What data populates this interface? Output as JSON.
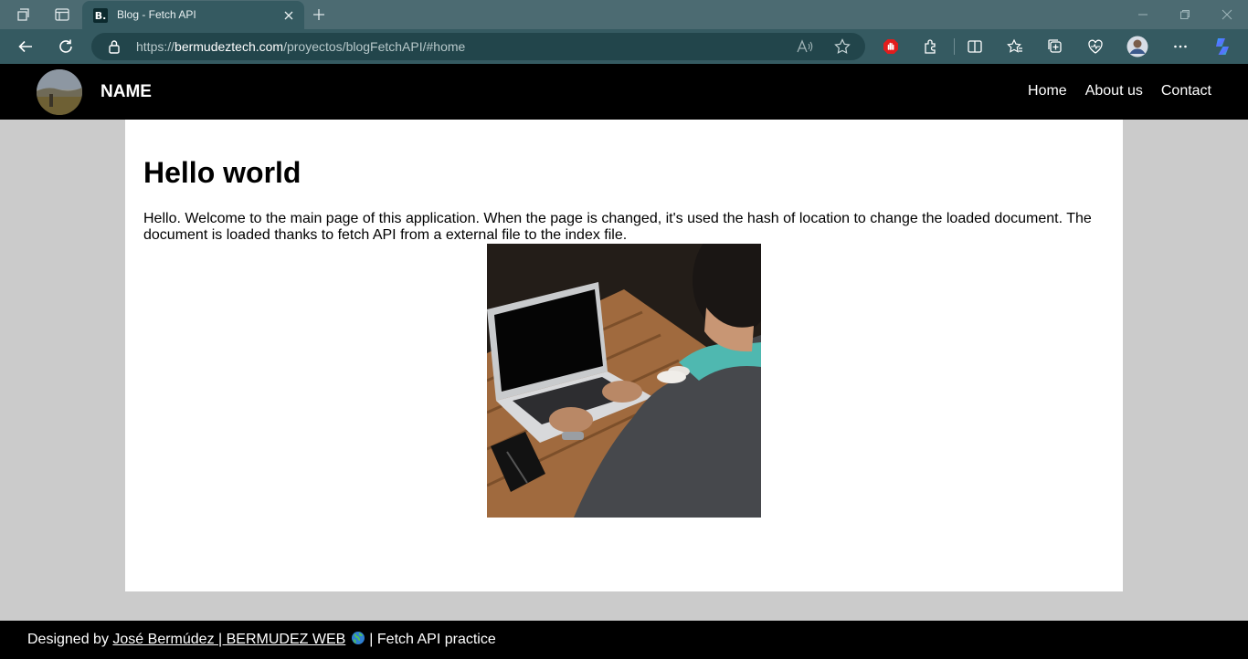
{
  "browser": {
    "tab": {
      "favicon_letter": "B.",
      "title": "Blog - Fetch API"
    },
    "url": {
      "scheme": "https://",
      "domain": "bermudeztech.com",
      "path": "/proyectos/blogFetchAPI/#home"
    },
    "colors": {
      "tabbar": "#4c6b72",
      "toolbar": "#355a61",
      "addressbar": "#22454b"
    }
  },
  "site": {
    "name": "NAME",
    "nav": [
      "Home",
      "About us",
      "Contact"
    ],
    "title": "Hello world",
    "intro": "Hello. Welcome to the main page of this application. When the page is changed, it's used the hash of location to change the loaded document. The document is loaded thanks to fetch API from a external file to the index file.",
    "footer": {
      "prefix": "Designed by",
      "link_text": "José Bermúdez | BERMUDEZ WEB",
      "suffix": "| Fetch API practice"
    }
  }
}
